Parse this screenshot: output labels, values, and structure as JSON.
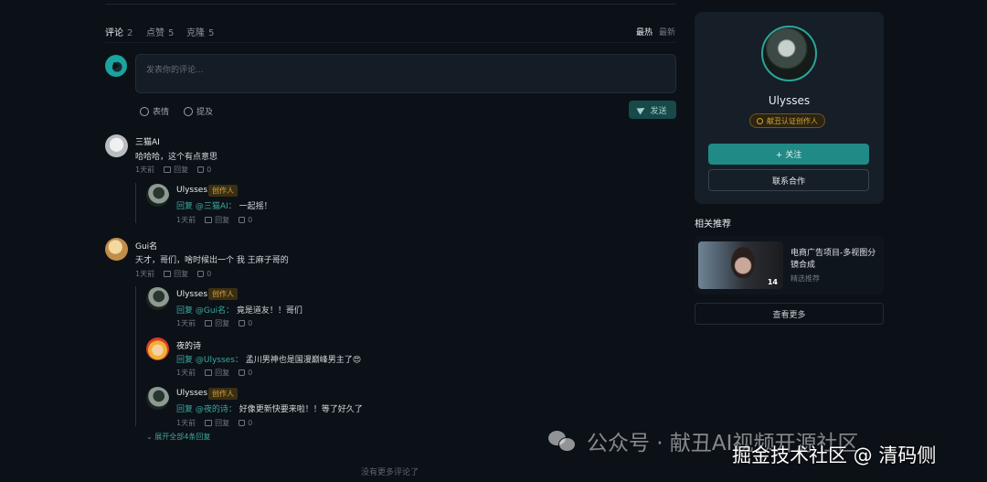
{
  "tabs": [
    {
      "label": "评论",
      "count": "2"
    },
    {
      "label": "点赞",
      "count": "5"
    },
    {
      "label": "克隆",
      "count": "5"
    }
  ],
  "sort": {
    "hot": "最热",
    "new": "最新"
  },
  "editor": {
    "placeholder": "发表你的评论..."
  },
  "toolbar": {
    "emoji": "表情",
    "mention": "提及",
    "send": "发送"
  },
  "comments": [
    {
      "name": "三猫AI",
      "text": "哈哈哈，这个有点意思",
      "time": "1天前",
      "reply": "回复",
      "likes": "0",
      "replies": [
        {
          "name": "Ulysses",
          "badge": "创作人",
          "to": "回复 @三猫AI：",
          "text": "一起摇！",
          "time": "1天前",
          "reply": "回复",
          "likes": "0"
        }
      ]
    },
    {
      "name": "Gui名",
      "text": "天才，哥们，啥时候出一个 我 王麻子哥的",
      "time": "1天前",
      "reply": "回复",
      "likes": "0",
      "replies": [
        {
          "name": "Ulysses",
          "badge": "创作人",
          "to": "回复 @Gui名：",
          "text": "竟是道友！！哥们",
          "time": "1天前",
          "reply": "回复",
          "likes": "0"
        },
        {
          "name": "夜的诗",
          "badge": "",
          "to": "回复 @Ulysses：",
          "text": "孟川男神也是国漫巅峰男主了😍",
          "time": "1天前",
          "reply": "回复",
          "likes": "0"
        },
        {
          "name": "Ulysses",
          "badge": "创作人",
          "to": "回复 @夜的诗：",
          "text": "好像更新快要来啦！！等了好久了",
          "time": "1天前",
          "reply": "回复",
          "likes": "0"
        }
      ],
      "expand": "展开全部4条回复"
    }
  ],
  "no_more": "没有更多评论了",
  "author": {
    "name": "Ulysses",
    "cert": "献丑认证创作人",
    "follow": "+ 关注",
    "cooperate": "联系合作"
  },
  "related": {
    "title": "相关推荐",
    "items": [
      {
        "name": "电商广告项目-多视图分镜合成",
        "tag": "精选推荐",
        "count": "14"
      }
    ],
    "more": "查看更多"
  },
  "watermarks": {
    "wechat": "公众号 · 献丑AI视频开源社区",
    "juejin": "掘金技术社区 @ 清码侧"
  }
}
